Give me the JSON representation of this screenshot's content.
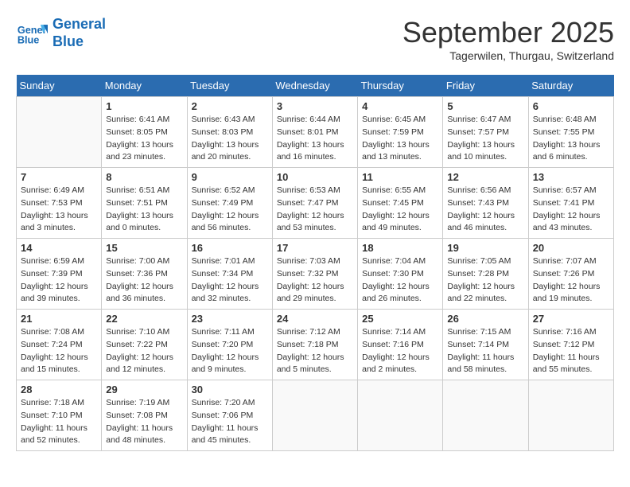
{
  "logo": {
    "line1": "General",
    "line2": "Blue"
  },
  "title": "September 2025",
  "subtitle": "Tagerwilen, Thurgau, Switzerland",
  "weekdays": [
    "Sunday",
    "Monday",
    "Tuesday",
    "Wednesday",
    "Thursday",
    "Friday",
    "Saturday"
  ],
  "weeks": [
    [
      {
        "day": "",
        "info": ""
      },
      {
        "day": "1",
        "info": "Sunrise: 6:41 AM\nSunset: 8:05 PM\nDaylight: 13 hours\nand 23 minutes."
      },
      {
        "day": "2",
        "info": "Sunrise: 6:43 AM\nSunset: 8:03 PM\nDaylight: 13 hours\nand 20 minutes."
      },
      {
        "day": "3",
        "info": "Sunrise: 6:44 AM\nSunset: 8:01 PM\nDaylight: 13 hours\nand 16 minutes."
      },
      {
        "day": "4",
        "info": "Sunrise: 6:45 AM\nSunset: 7:59 PM\nDaylight: 13 hours\nand 13 minutes."
      },
      {
        "day": "5",
        "info": "Sunrise: 6:47 AM\nSunset: 7:57 PM\nDaylight: 13 hours\nand 10 minutes."
      },
      {
        "day": "6",
        "info": "Sunrise: 6:48 AM\nSunset: 7:55 PM\nDaylight: 13 hours\nand 6 minutes."
      }
    ],
    [
      {
        "day": "7",
        "info": "Sunrise: 6:49 AM\nSunset: 7:53 PM\nDaylight: 13 hours\nand 3 minutes."
      },
      {
        "day": "8",
        "info": "Sunrise: 6:51 AM\nSunset: 7:51 PM\nDaylight: 13 hours\nand 0 minutes."
      },
      {
        "day": "9",
        "info": "Sunrise: 6:52 AM\nSunset: 7:49 PM\nDaylight: 12 hours\nand 56 minutes."
      },
      {
        "day": "10",
        "info": "Sunrise: 6:53 AM\nSunset: 7:47 PM\nDaylight: 12 hours\nand 53 minutes."
      },
      {
        "day": "11",
        "info": "Sunrise: 6:55 AM\nSunset: 7:45 PM\nDaylight: 12 hours\nand 49 minutes."
      },
      {
        "day": "12",
        "info": "Sunrise: 6:56 AM\nSunset: 7:43 PM\nDaylight: 12 hours\nand 46 minutes."
      },
      {
        "day": "13",
        "info": "Sunrise: 6:57 AM\nSunset: 7:41 PM\nDaylight: 12 hours\nand 43 minutes."
      }
    ],
    [
      {
        "day": "14",
        "info": "Sunrise: 6:59 AM\nSunset: 7:39 PM\nDaylight: 12 hours\nand 39 minutes."
      },
      {
        "day": "15",
        "info": "Sunrise: 7:00 AM\nSunset: 7:36 PM\nDaylight: 12 hours\nand 36 minutes."
      },
      {
        "day": "16",
        "info": "Sunrise: 7:01 AM\nSunset: 7:34 PM\nDaylight: 12 hours\nand 32 minutes."
      },
      {
        "day": "17",
        "info": "Sunrise: 7:03 AM\nSunset: 7:32 PM\nDaylight: 12 hours\nand 29 minutes."
      },
      {
        "day": "18",
        "info": "Sunrise: 7:04 AM\nSunset: 7:30 PM\nDaylight: 12 hours\nand 26 minutes."
      },
      {
        "day": "19",
        "info": "Sunrise: 7:05 AM\nSunset: 7:28 PM\nDaylight: 12 hours\nand 22 minutes."
      },
      {
        "day": "20",
        "info": "Sunrise: 7:07 AM\nSunset: 7:26 PM\nDaylight: 12 hours\nand 19 minutes."
      }
    ],
    [
      {
        "day": "21",
        "info": "Sunrise: 7:08 AM\nSunset: 7:24 PM\nDaylight: 12 hours\nand 15 minutes."
      },
      {
        "day": "22",
        "info": "Sunrise: 7:10 AM\nSunset: 7:22 PM\nDaylight: 12 hours\nand 12 minutes."
      },
      {
        "day": "23",
        "info": "Sunrise: 7:11 AM\nSunset: 7:20 PM\nDaylight: 12 hours\nand 9 minutes."
      },
      {
        "day": "24",
        "info": "Sunrise: 7:12 AM\nSunset: 7:18 PM\nDaylight: 12 hours\nand 5 minutes."
      },
      {
        "day": "25",
        "info": "Sunrise: 7:14 AM\nSunset: 7:16 PM\nDaylight: 12 hours\nand 2 minutes."
      },
      {
        "day": "26",
        "info": "Sunrise: 7:15 AM\nSunset: 7:14 PM\nDaylight: 11 hours\nand 58 minutes."
      },
      {
        "day": "27",
        "info": "Sunrise: 7:16 AM\nSunset: 7:12 PM\nDaylight: 11 hours\nand 55 minutes."
      }
    ],
    [
      {
        "day": "28",
        "info": "Sunrise: 7:18 AM\nSunset: 7:10 PM\nDaylight: 11 hours\nand 52 minutes."
      },
      {
        "day": "29",
        "info": "Sunrise: 7:19 AM\nSunset: 7:08 PM\nDaylight: 11 hours\nand 48 minutes."
      },
      {
        "day": "30",
        "info": "Sunrise: 7:20 AM\nSunset: 7:06 PM\nDaylight: 11 hours\nand 45 minutes."
      },
      {
        "day": "",
        "info": ""
      },
      {
        "day": "",
        "info": ""
      },
      {
        "day": "",
        "info": ""
      },
      {
        "day": "",
        "info": ""
      }
    ]
  ]
}
